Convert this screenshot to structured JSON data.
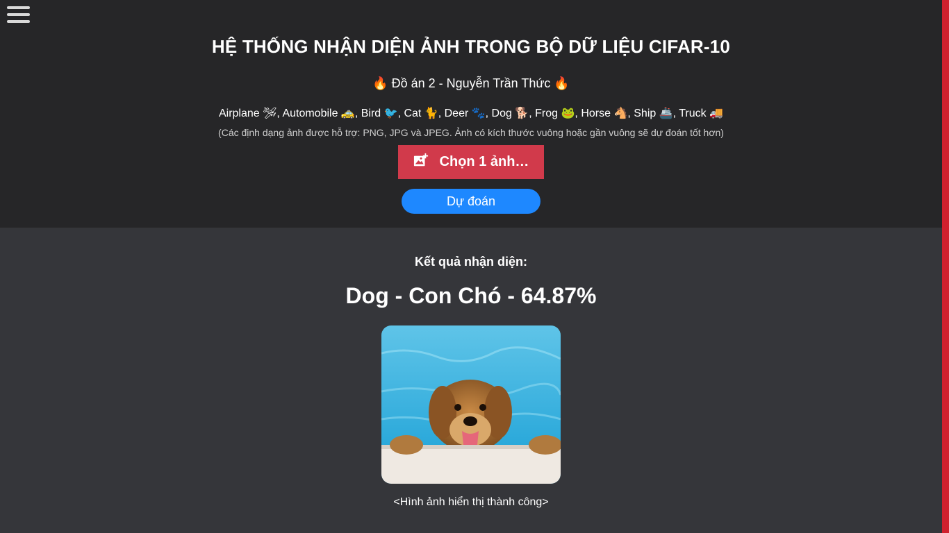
{
  "menu": {
    "icon": "hamburger-menu-icon"
  },
  "header": {
    "title": "HỆ THỐNG NHẬN DIỆN ẢNH TRONG BỘ DỮ LIỆU CIFAR-10",
    "subtitle": "🔥 Đồ án 2 - Nguyễn Trần Thức 🔥",
    "classes": "Airplane 🛩, Automobile 🚕, Bird 🐦, Cat 🐈, Deer 🐾, Dog 🐕, Frog 🐸, Horse 🐴, Ship 🚢, Truck 🚚",
    "note": "(Các định dạng ảnh được hỗ trợ: PNG, JPG và JPEG. Ảnh có kích thước vuông hoặc gần vuông sẽ dự đoán tốt hơn)"
  },
  "upload": {
    "label": "Chọn 1 ảnh…",
    "icon": "add-image-icon"
  },
  "predict": {
    "label": "Dự đoán"
  },
  "result": {
    "label": "Kết quả nhận diện:",
    "value": "Dog - Con Chó - 64.87%",
    "caption": "<Hình ảnh hiển thị thành công>"
  },
  "colors": {
    "header_bg": "#262628",
    "body_bg": "#35363a",
    "upload_button": "#d13a4b",
    "predict_button": "#1e88ff",
    "scroll_accent": "#d0202e"
  }
}
